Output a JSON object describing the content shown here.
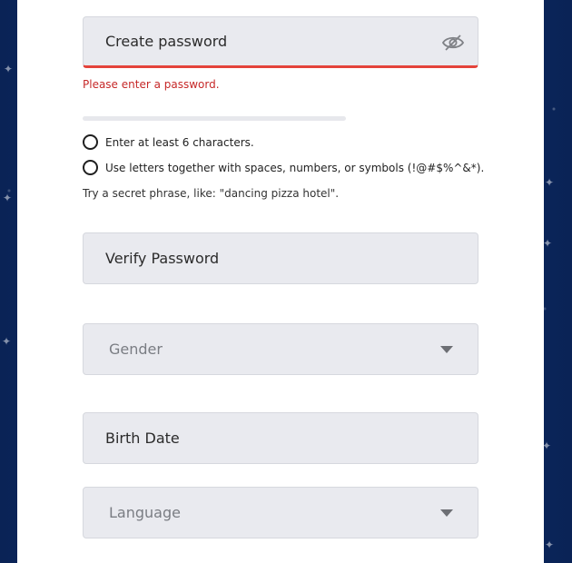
{
  "password": {
    "placeholder": "Create password",
    "error": "Please enter a password.",
    "toggle_icon": "eye-slash-icon"
  },
  "requirements": [
    "Enter at least 6 characters.",
    "Use letters together with spaces, numbers, or symbols (!@#$%^&*)."
  ],
  "hint": "Try a secret phrase, like: \"dancing pizza hotel\".",
  "verify": {
    "placeholder": "Verify Password"
  },
  "gender": {
    "placeholder": "Gender"
  },
  "birth_date": {
    "placeholder": "Birth Date"
  },
  "language": {
    "placeholder": "Language"
  },
  "colors": {
    "error": "#e4433b",
    "field_bg": "#e9eaef",
    "page_bg": "#0b2a66"
  }
}
